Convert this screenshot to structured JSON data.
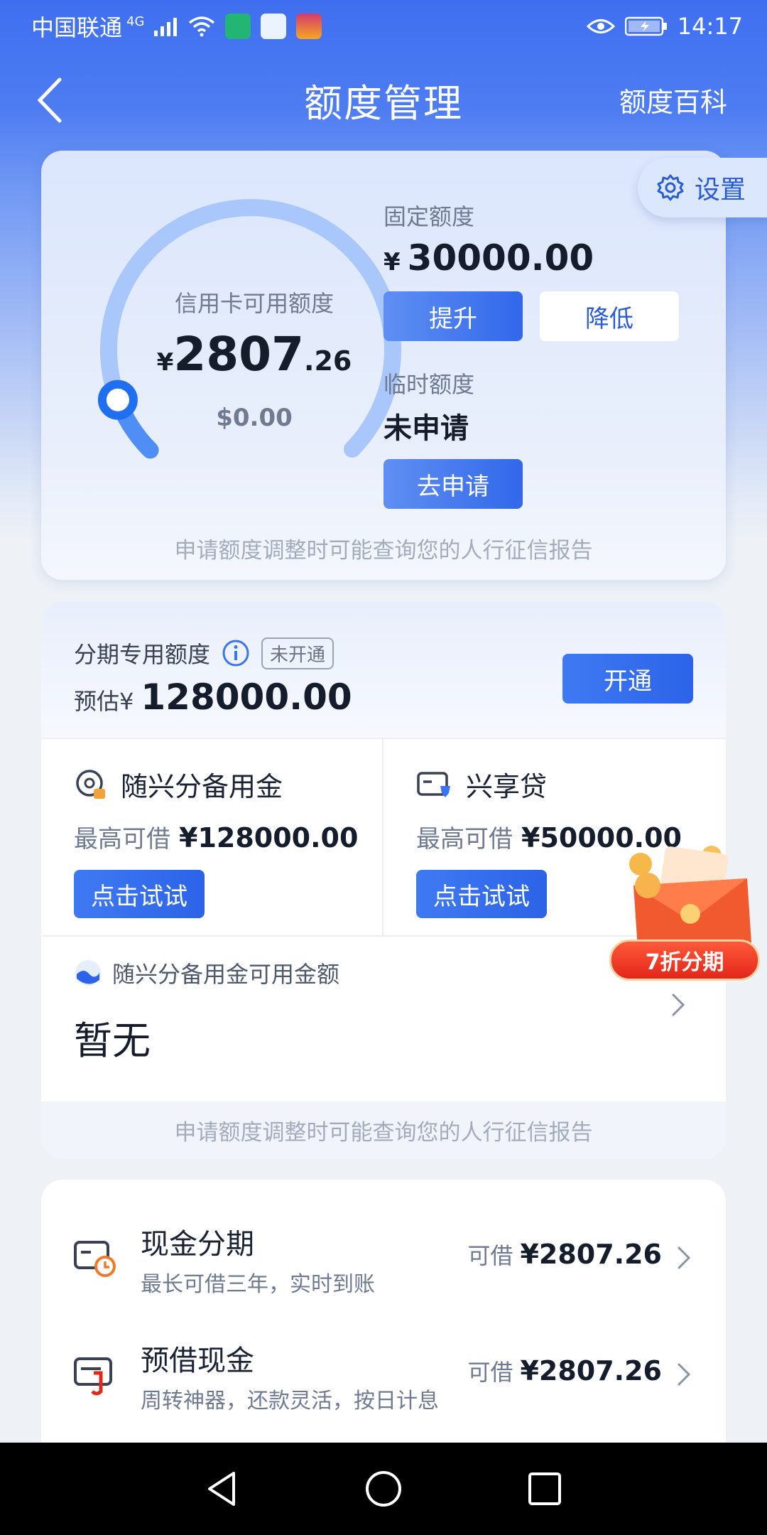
{
  "status_bar": {
    "carrier": "中国联通",
    "network": "4G",
    "time": "14:17"
  },
  "nav": {
    "title": "额度管理",
    "right_link": "额度百科"
  },
  "settings": {
    "label": "设置"
  },
  "credit_card": {
    "gauge_title": "信用卡可用额度",
    "currency": "¥",
    "amount_int": "2807",
    "amount_dec": ".26",
    "usd": "$0.00",
    "available_fraction": 0.09,
    "fixed_label": "固定额度",
    "fixed_value": "30000.00",
    "raise_btn": "提升",
    "lower_btn": "降低",
    "temp_label": "临时额度",
    "temp_value": "未申请",
    "apply_btn": "去申请",
    "footer_note": "申请额度调整时可能查询您的人行征信报告"
  },
  "installment": {
    "title": "分期专用额度",
    "status_tag": "未开通",
    "estimate_prefix": "预估¥",
    "estimate_value": "128000.00",
    "open_btn": "开通",
    "products": [
      {
        "name": "随兴分备用金",
        "max_label": "最高可借",
        "max_value": "¥128000.00",
        "btn": "点击试试"
      },
      {
        "name": "兴享贷",
        "max_label": "最高可借",
        "max_value": "¥50000.00",
        "btn": "点击试试"
      }
    ],
    "available_title": "随兴分备用金可用金额",
    "available_value": "暂无",
    "footer_note": "申请额度调整时可能查询您的人行征信报告"
  },
  "promo": {
    "label": "7折分期"
  },
  "cash_list": [
    {
      "title": "现金分期",
      "subtitle": "最长可借三年，实时到账",
      "right_label": "可借",
      "right_value": "¥2807.26"
    },
    {
      "title": "预借现金",
      "subtitle": "周转神器，还款灵活，按日计息",
      "right_label": "可借",
      "right_value": "¥2807.26"
    }
  ],
  "colors": {
    "primary": "#2c63e8",
    "header": "#3f6ff0",
    "promo_red": "#e3261a"
  }
}
